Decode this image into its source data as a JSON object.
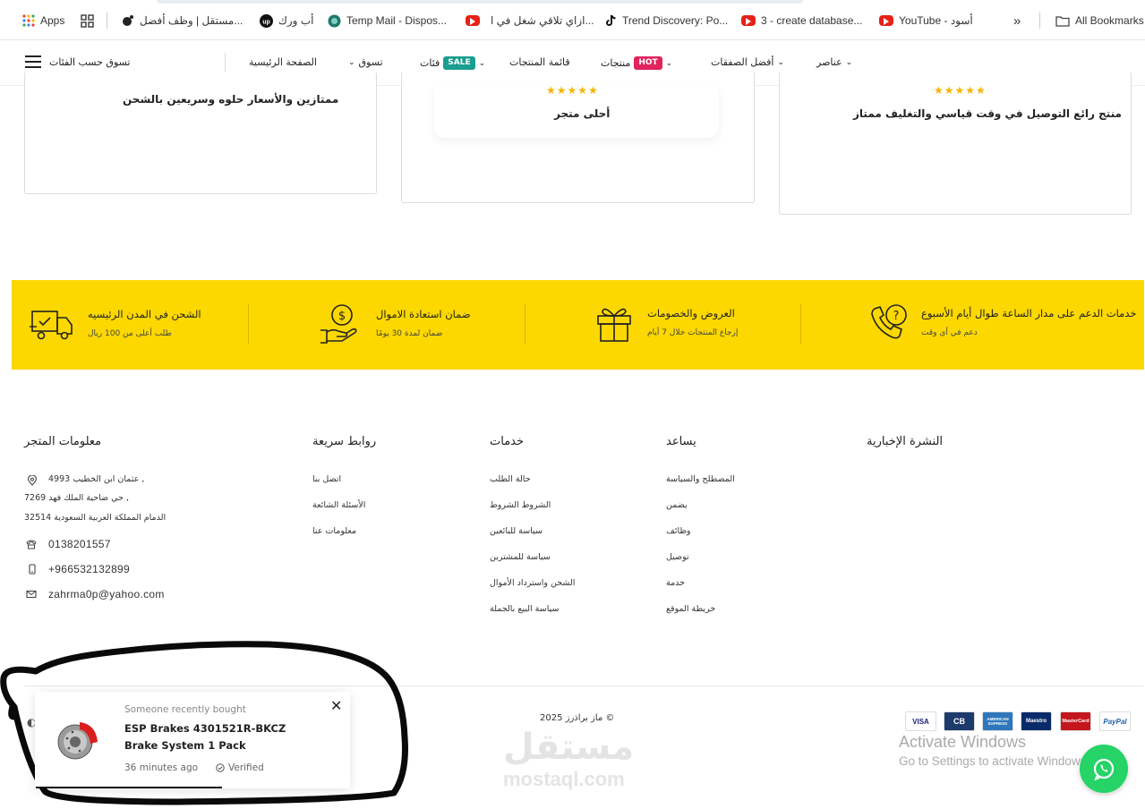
{
  "bookmarks": {
    "items": [
      {
        "label": "Apps",
        "icon": "apps-grid-icon"
      },
      {
        "label": "",
        "icon": "tab-grid-icon"
      },
      {
        "label": "مستقل | وظف أفضل...",
        "icon": "mostaql-icon"
      },
      {
        "label": "أب ورك",
        "icon": "upwork-icon"
      },
      {
        "label": "Temp Mail - Dispos...",
        "icon": "tempmail-icon"
      },
      {
        "label": "ازاي تلاقي شغل في ا...",
        "icon": "youtube-icon"
      },
      {
        "label": "Trend Discovery: Po...",
        "icon": "tiktok-icon"
      },
      {
        "label": "3 - create database...",
        "icon": "youtube-icon"
      },
      {
        "label": "YouTube - أسود",
        "icon": "youtube-icon"
      }
    ],
    "more": "»",
    "all_bookmarks": "All Bookmarks"
  },
  "nav": {
    "categories": "تسوق حسب الفئات",
    "home": "الصفحة الرئيسية",
    "shop": "تسوق",
    "cats": "فئات",
    "cats_badge": "SALE",
    "product_list": "قائمة المنتجات",
    "products": "منتجات",
    "products_badge": "HOT",
    "best_deals": "أفضل الصفقات",
    "elements": "عناصر",
    "badge_colors": {
      "sale": "#1a9e8f",
      "hot": "#e0245e"
    }
  },
  "reviews": [
    {
      "text": "ممتازين والأسعار حلوه وسريعين بالشحن",
      "rating": null
    },
    {
      "text": "أحلى متجر",
      "rating": 5
    },
    {
      "text": "منتج رائع التوصيل في وقت قياسي والتغليف ممتاز",
      "rating": 5
    }
  ],
  "features": [
    {
      "title": "الشحن في المدن الرئيسيه",
      "sub": "طلب أعلى من 100 ريال",
      "icon": "truck-icon"
    },
    {
      "title": "ضمان استعادة الاموال",
      "sub": "ضمان لمدة 30 يومًا",
      "icon": "money-hand-icon"
    },
    {
      "title": "العروض والخصومات",
      "sub": "إرجاع المنتجات خلال 7 أيام",
      "icon": "gift-icon"
    },
    {
      "title": "خدمات الدعم على مدار الساعة طوال أيام الأسبوع",
      "sub": "دعم في أي وقت",
      "icon": "support-phone-icon"
    }
  ],
  "footer": {
    "store_info": {
      "title": "معلومات المتجر",
      "address_lines": [
        "عثمان ابن الخطيب 4993 ,",
        "حي ضاحية الملك فهد 7269 ,",
        "الدمام المملكة العربية السعودية 32514"
      ],
      "phone": "0138201557",
      "mobile": "+966532132899",
      "email": "zahrma0p@yahoo.com"
    },
    "quick_links": {
      "title": "روابط سريعة",
      "items": [
        "اتصل بنا",
        "الأسئلة الشائعة",
        "معلومات عنا"
      ]
    },
    "services": {
      "title": "خدمات",
      "items": [
        "حالة الطلب",
        "الشروط الشروط",
        "سياسة للبائعين",
        "سياسة للمشترين",
        "الشحن واسترداد الأموال",
        "سياسة البيع بالجملة"
      ]
    },
    "help": {
      "title": "يساعد",
      "items": [
        "المصطلح والسياسة",
        "يضمن",
        "وظائف",
        "توصيل",
        "خدمة",
        "خريطة الموقع"
      ]
    },
    "newsletter": {
      "title": "النشرة الإخبارية"
    },
    "copyright": "ماز براذرز 2025 ©",
    "watermark_ar": "مستقل",
    "watermark_en": "mostaql.com",
    "payments": [
      "VISA",
      "CB",
      "AMERICAN EXPRESS",
      "Maestro",
      "MasterCard",
      "PayPal"
    ],
    "windows": {
      "line1": "Activate Windows",
      "line2": "Go to Settings to activate Windows."
    }
  },
  "popup": {
    "kicker": "Someone recently bought",
    "product": "ESP Brakes 4301521R-BKCZ Brake System 1 Pack",
    "time": "36 minutes ago",
    "verified": "Verified",
    "close": "✕"
  },
  "colors": {
    "yellow": "#fcd800",
    "whatsapp": "#25d366"
  }
}
